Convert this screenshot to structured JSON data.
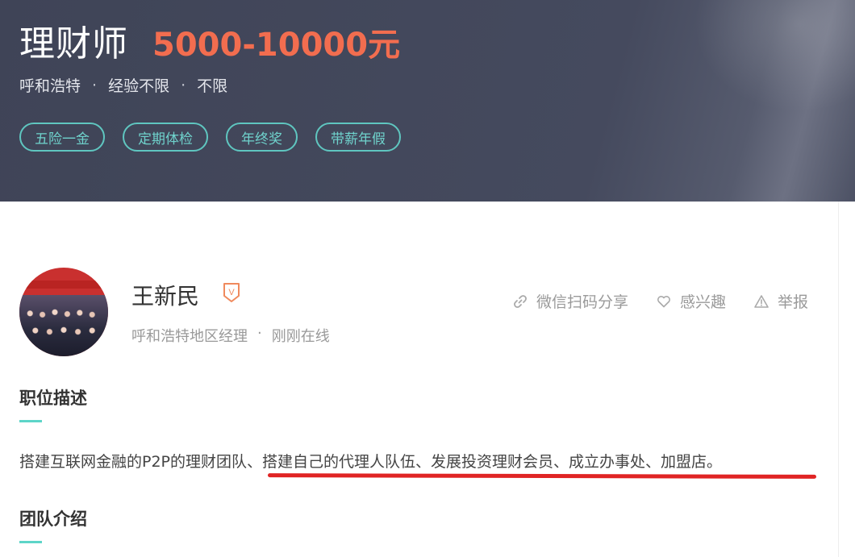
{
  "header": {
    "job_title": "理财师",
    "salary": "5000-10000元",
    "meta": [
      "呼和浩特",
      "经验不限",
      "不限"
    ],
    "meta_separator": "·",
    "tags": [
      "五险一金",
      "定期体检",
      "年终奖",
      "带薪年假"
    ]
  },
  "recruiter": {
    "name": "王新民",
    "verified_badge_letter": "V",
    "title": "呼和浩特地区经理",
    "separator": "·",
    "status": "刚刚在线"
  },
  "actions": {
    "share": "微信扫码分享",
    "interested": "感兴趣",
    "report": "举报"
  },
  "sections": {
    "description": {
      "title": "职位描述",
      "text": "搭建互联网金融的P2P的理财团队、搭建自己的代理人队伍、发展投资理财会员、成立办事处、加盟店。"
    },
    "team": {
      "title": "团队介绍"
    }
  },
  "colors": {
    "banner_bg": "#434859",
    "salary": "#f26d4f",
    "tag_border": "#5fc6c0",
    "accent_underline": "#5dd5c8",
    "annotation_red": "#e02424"
  },
  "icons": {
    "share": "link-icon",
    "interested": "heart-icon",
    "report": "warning-icon",
    "verified": "verified-v-badge-icon"
  }
}
